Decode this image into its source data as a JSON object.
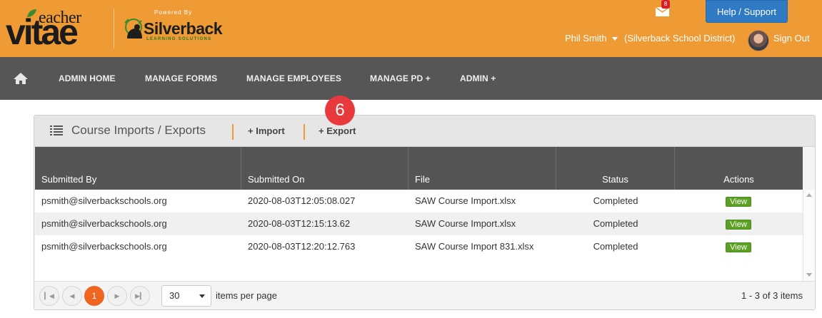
{
  "header": {
    "logo": {
      "teacher": "eacher",
      "vitae": "vitae"
    },
    "powered_by": "Powered By",
    "partner": {
      "name": "Silverback",
      "sub": "LEARNING SOLUTIONS"
    },
    "mail_count": "8",
    "help_label": "Help / Support",
    "user_name": "Phil Smith",
    "district": "(Silverback School District)",
    "sign_out": "Sign Out",
    "brand_color": "#ee9a35"
  },
  "nav": {
    "home_icon": "home-icon",
    "items": [
      "ADMIN HOME",
      "MANAGE FORMS",
      "MANAGE EMPLOYEES",
      "MANAGE PD +",
      "ADMIN +"
    ]
  },
  "step_badge": "6",
  "panel": {
    "title": "Course Imports / Exports",
    "import_label": "+ Import",
    "export_label": "+ Export",
    "columns": [
      "Submitted By",
      "Submitted On",
      "File",
      "Status",
      "Actions"
    ],
    "rows": [
      {
        "by": "psmith@silverbackschools.org",
        "on": "2020-08-03T12:05:08.027",
        "file": "SAW Course Import.xlsx",
        "status": "Completed",
        "action": "View"
      },
      {
        "by": "psmith@silverbackschools.org",
        "on": "2020-08-03T12:15:13.62",
        "file": "SAW Course Import.xlsx",
        "status": "Completed",
        "action": "View"
      },
      {
        "by": "psmith@silverbackschools.org",
        "on": "2020-08-03T12:20:12.763",
        "file": "SAW Course Import 831.xlsx",
        "status": "Completed",
        "action": "View"
      }
    ],
    "pager": {
      "current_page": "1",
      "page_size": "30",
      "per_page_label": "items per page",
      "summary": "1 - 3 of 3 items"
    }
  }
}
